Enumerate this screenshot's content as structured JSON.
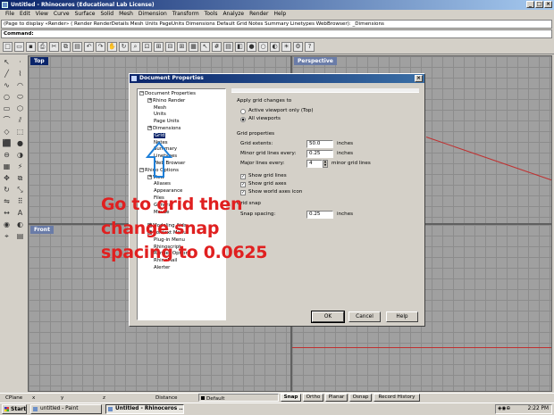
{
  "window": {
    "title": "Untitled - Rhinoceros (Educational Lab License)",
    "buttons": [
      "_",
      "□",
      "×"
    ]
  },
  "menubar": [
    "File",
    "Edit",
    "View",
    "Curve",
    "Surface",
    "Solid",
    "Mesh",
    "Dimension",
    "Transform",
    "Tools",
    "Analyze",
    "Render",
    "Help"
  ],
  "command": {
    "history": "(Page to display «Render» ( Render RenderDetails Mesh Units PageUnits Dimensions Default Grid Notes Summary Linetypes WebBrowser): _Dimensions",
    "prompt": "Command:"
  },
  "viewports": {
    "top": "Top",
    "perspective": "Perspective",
    "front": "Front",
    "right": ""
  },
  "dialog": {
    "title": "Document Properties",
    "close": "×",
    "tree": [
      {
        "label": "Document Properties",
        "exp": "−",
        "indent": 0
      },
      {
        "label": "Rhino Render",
        "exp": "+",
        "indent": 1
      },
      {
        "label": "Mesh",
        "exp": "",
        "indent": 1
      },
      {
        "label": "Units",
        "exp": "",
        "indent": 1
      },
      {
        "label": "Page Units",
        "exp": "",
        "indent": 1
      },
      {
        "label": "Dimensions",
        "exp": "+",
        "indent": 1
      },
      {
        "label": "Grid",
        "exp": "",
        "indent": 1,
        "selected": true
      },
      {
        "label": "Notes",
        "exp": "",
        "indent": 1
      },
      {
        "label": "Summary",
        "exp": "",
        "indent": 1
      },
      {
        "label": "Linetypes",
        "exp": "",
        "indent": 1
      },
      {
        "label": "Web Browser",
        "exp": "",
        "indent": 1
      },
      {
        "label": "Rhino Options",
        "exp": "−",
        "indent": 0
      },
      {
        "label": "View",
        "exp": "+",
        "indent": 1
      },
      {
        "label": "Aliases",
        "exp": "",
        "indent": 1
      },
      {
        "label": "Appearance",
        "exp": "",
        "indent": 1
      },
      {
        "label": "Files",
        "exp": "",
        "indent": 1
      },
      {
        "label": "General",
        "exp": "",
        "indent": 1
      },
      {
        "label": "Mouse",
        "exp": "",
        "indent": 1
      },
      {
        "label": "",
        "exp": "",
        "indent": 1
      },
      {
        "label": "Modeling Aids",
        "exp": "+",
        "indent": 1
      },
      {
        "label": "Context Menu",
        "exp": "+",
        "indent": 1
      },
      {
        "label": "Plug-in Menu",
        "exp": "",
        "indent": 1
      },
      {
        "label": "Rhinoscript",
        "exp": "",
        "indent": 1
      },
      {
        "label": "Render Options",
        "exp": "",
        "indent": 1
      },
      {
        "label": "RhinoMail",
        "exp": "",
        "indent": 1
      },
      {
        "label": "Alerter",
        "exp": "",
        "indent": 1
      }
    ],
    "panel": {
      "apply_heading": "Apply grid changes to",
      "radio_active": "Active viewport only (Top)",
      "radio_all": "All viewports",
      "props_heading": "Grid properties",
      "grid_extents_label": "Grid extents:",
      "grid_extents_value": "50.0",
      "minor_label": "Minor grid lines every:",
      "minor_value": "0.25",
      "major_label": "Major lines every:",
      "major_value": "4",
      "unit_inches": "inches",
      "unit_minor": "minor grid lines",
      "show_grid_lines": "Show grid lines",
      "show_grid_axes": "Show grid axes",
      "show_world_axes": "Show world axes icon",
      "snap_heading": "Grid snap",
      "snap_label": "Snap spacing:",
      "snap_value": "0.25"
    },
    "buttons": {
      "ok": "OK",
      "cancel": "Cancel",
      "help": "Help"
    }
  },
  "annotation": {
    "line1": "Go to grid then",
    "line2": "change snap",
    "line3": "spacing to 0.0625"
  },
  "status": {
    "cplane": "CPlane",
    "x": "x",
    "y": "y",
    "z": "z",
    "distance": "Distance",
    "layer": "Default",
    "snap": "Snap",
    "ortho": "Ortho",
    "planar": "Planar",
    "osnap": "Osnap",
    "record": "Record History"
  },
  "taskbar": {
    "start": "Start",
    "task1": "untitled - Paint",
    "task2": "Untitled - Rhinoceros ...",
    "clock": "2:22 PM"
  }
}
